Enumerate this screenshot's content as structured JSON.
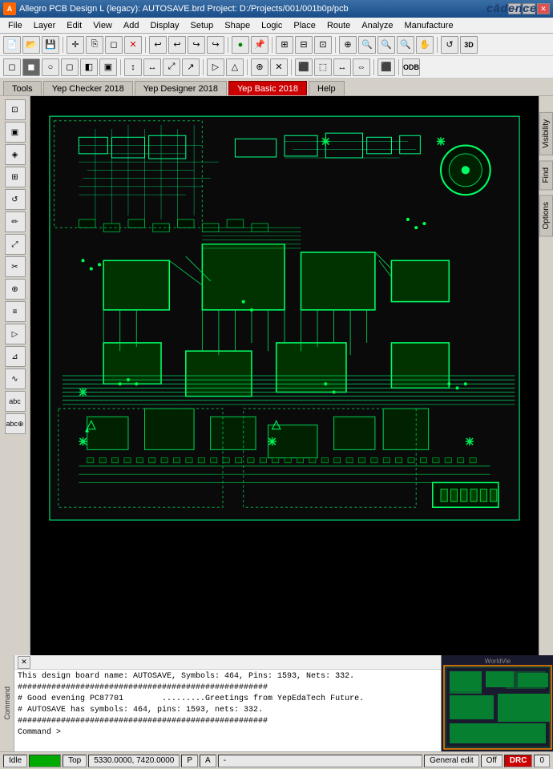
{
  "titlebar": {
    "title": "Allegro PCB Design L (legacy): AUTOSAVE.brd  Project: D:/Projects/001/001b0p/pcb",
    "icon_label": "A",
    "controls": {
      "minimize": "─",
      "maximize": "□",
      "close": "✕"
    }
  },
  "menubar": {
    "items": [
      "File",
      "Layer",
      "Edit",
      "View",
      "Add",
      "Display",
      "Setup",
      "Shape",
      "Logic",
      "Place",
      "Route",
      "Analyze",
      "Manufacture"
    ]
  },
  "tabs": {
    "tools": "Tools",
    "yep_checker": "Yep Checker 2018",
    "yep_designer": "Yep Designer 2018",
    "yep_basic": "Yep Basic 2018",
    "help": "Help"
  },
  "right_panel": {
    "visibility_label": "Visibility",
    "find_label": "Find",
    "options_label": "Options"
  },
  "console": {
    "lines": [
      "This design board name: AUTOSAVE, Symbols: 464, Pins: 1593, Nets: 332.",
      "####################################################",
      "# Good evening PC87701        .........Greetings from YepEdaTech Future.",
      "# AUTOSAVE has symbols: 464, pins: 1593, nets: 332.",
      "####################################################",
      "Command >"
    ]
  },
  "statusbar": {
    "idle": "Idle",
    "active_indicator": "",
    "layer": "Top",
    "coordinates": "5330.0000, 7420.0000",
    "unit1": "P",
    "unit2": "A",
    "separator": "-",
    "mode": "General edit",
    "drc_off": "Off",
    "drc": "DRC",
    "count": "0"
  },
  "toolbar1": {
    "buttons": [
      {
        "name": "new",
        "icon": "📄"
      },
      {
        "name": "open",
        "icon": "📂"
      },
      {
        "name": "save",
        "icon": "💾"
      },
      {
        "name": "snap",
        "icon": "✛"
      },
      {
        "name": "copy",
        "icon": "⎘"
      },
      {
        "name": "delete",
        "icon": "✕"
      },
      {
        "name": "undo",
        "icon": "↩"
      },
      {
        "name": "redo-undo",
        "icon": "↪"
      },
      {
        "name": "undo2",
        "icon": "↩"
      },
      {
        "name": "redo",
        "icon": "↪"
      },
      {
        "name": "run",
        "icon": "●"
      },
      {
        "name": "pin",
        "icon": "📌"
      },
      {
        "name": "grid",
        "icon": "⊞"
      },
      {
        "name": "grid2",
        "icon": "⊟"
      },
      {
        "name": "zoom-fit",
        "icon": "⊡"
      },
      {
        "name": "zoom-in",
        "icon": "🔍"
      },
      {
        "name": "zoom-out",
        "icon": "🔍"
      },
      {
        "name": "zoom-area",
        "icon": "⊕"
      },
      {
        "name": "pan",
        "icon": "✋"
      },
      {
        "name": "refresh",
        "icon": "↺"
      },
      {
        "name": "3d",
        "icon": "3D"
      }
    ]
  },
  "cadence_logo": "cādence",
  "minimap_label": "WorldVie"
}
